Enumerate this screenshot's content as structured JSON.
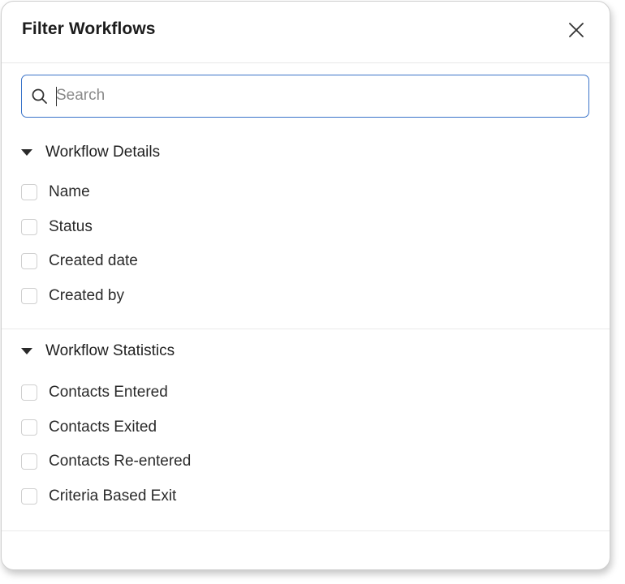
{
  "dialog": {
    "title": "Filter Workflows",
    "close_icon": "close-icon"
  },
  "search": {
    "placeholder": "Search",
    "value": "",
    "icon": "search-icon"
  },
  "sections": [
    {
      "label": "Workflow Details",
      "expanded": true,
      "options": [
        {
          "label": "Name",
          "checked": false
        },
        {
          "label": "Status",
          "checked": false
        },
        {
          "label": "Created date",
          "checked": false
        },
        {
          "label": "Created by",
          "checked": false
        }
      ]
    },
    {
      "label": "Workflow Statistics",
      "expanded": true,
      "options": [
        {
          "label": "Contacts Entered",
          "checked": false
        },
        {
          "label": "Contacts Exited",
          "checked": false
        },
        {
          "label": "Contacts Re-entered",
          "checked": false
        },
        {
          "label": "Criteria Based Exit",
          "checked": false
        }
      ]
    }
  ],
  "colors": {
    "accent": "#3b74c9",
    "text": "#1f1f1f",
    "border": "#cfcfcf"
  }
}
